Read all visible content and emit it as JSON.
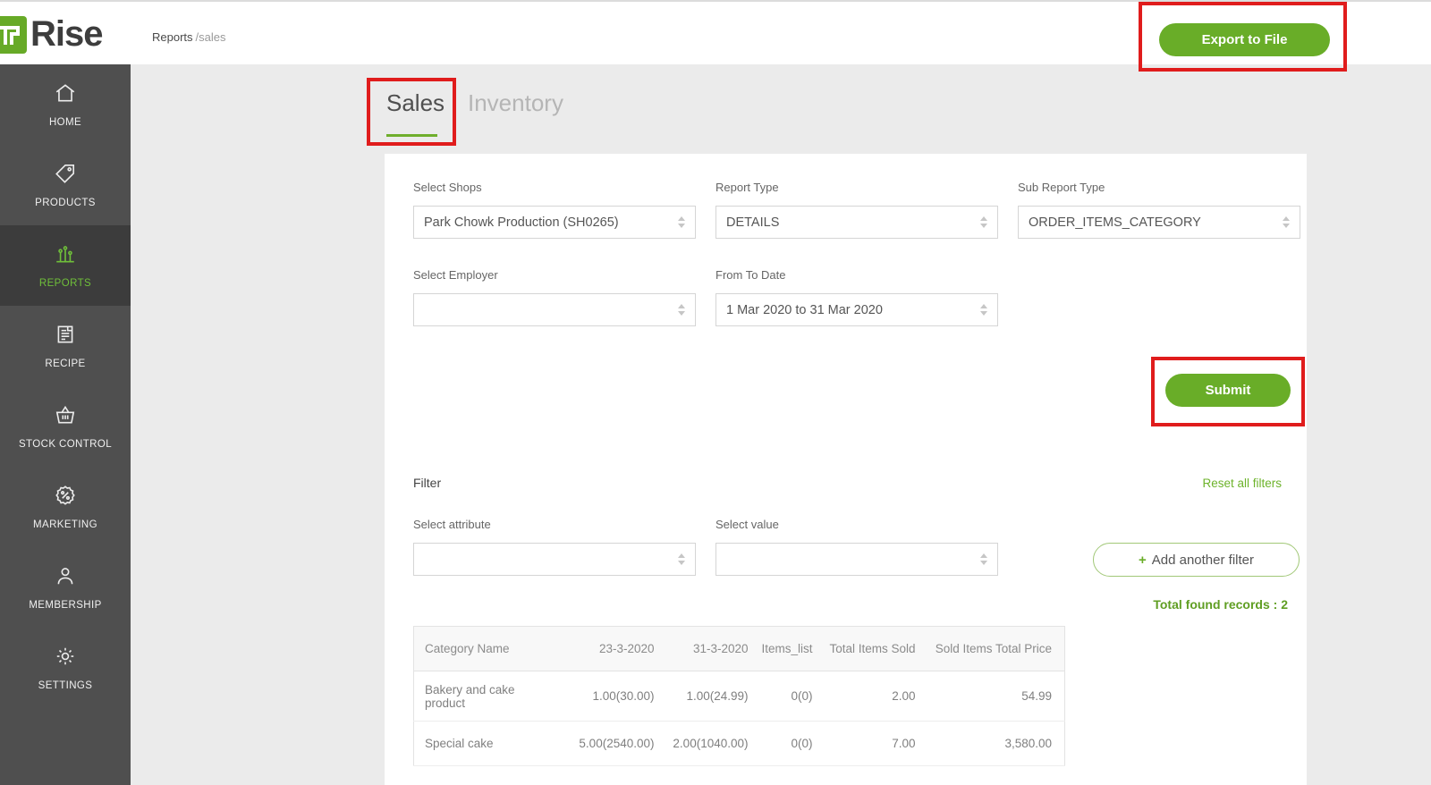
{
  "colors": {
    "brand_green": "#69ad28",
    "active_green": "#6fbf3a",
    "sidebar_gray": "#4f4f4f",
    "annotation_red": "#e01c1c"
  },
  "header": {
    "logo_text": "Rise",
    "breadcrumb": {
      "section": "Reports",
      "page": "/sales"
    },
    "export_button": "Export to File"
  },
  "sidebar": {
    "items": [
      {
        "label": "HOME",
        "icon": "home-icon",
        "active": false
      },
      {
        "label": "PRODUCTS",
        "icon": "tag-icon",
        "active": false
      },
      {
        "label": "REPORTS",
        "icon": "bar-chart-icon",
        "active": true
      },
      {
        "label": "RECIPE",
        "icon": "recipe-document-icon",
        "active": false
      },
      {
        "label": "STOCK CONTROL",
        "icon": "basket-icon",
        "active": false
      },
      {
        "label": "MARKETING",
        "icon": "badge-percent-icon",
        "active": false
      },
      {
        "label": "MEMBERSHIP",
        "icon": "person-icon",
        "active": false
      },
      {
        "label": "SETTINGS",
        "icon": "gear-icon",
        "active": false
      }
    ]
  },
  "tabs": {
    "sales": "Sales",
    "inventory": "Inventory"
  },
  "form": {
    "select_shops": {
      "label": "Select Shops",
      "value": "Park Chowk Production (SH0265)"
    },
    "report_type": {
      "label": "Report Type",
      "value": "DETAILS"
    },
    "sub_report_type": {
      "label": "Sub Report Type",
      "value": "ORDER_ITEMS_CATEGORY"
    },
    "select_employer": {
      "label": "Select Employer",
      "value": ""
    },
    "from_to_date": {
      "label": "From To Date",
      "value": "1 Mar 2020 to 31 Mar 2020"
    },
    "submit_label": "Submit"
  },
  "filter": {
    "title": "Filter",
    "reset_link": "Reset all filters",
    "select_attribute": {
      "label": "Select attribute",
      "value": ""
    },
    "select_value": {
      "label": "Select value",
      "value": ""
    },
    "add_plus": "+",
    "add_label": "Add another filter",
    "total_records": "Total found records : 2"
  },
  "table": {
    "columns": [
      "Category Name",
      "23-3-2020",
      "31-3-2020",
      "Items_list",
      "Total Items Sold",
      "Sold Items Total Price"
    ],
    "rows": [
      [
        "Bakery and cake product",
        "1.00(30.00)",
        "1.00(24.99)",
        "0(0)",
        "2.00",
        "54.99"
      ],
      [
        "Special cake",
        "5.00(2540.00)",
        "2.00(1040.00)",
        "0(0)",
        "7.00",
        "3,580.00"
      ]
    ]
  }
}
